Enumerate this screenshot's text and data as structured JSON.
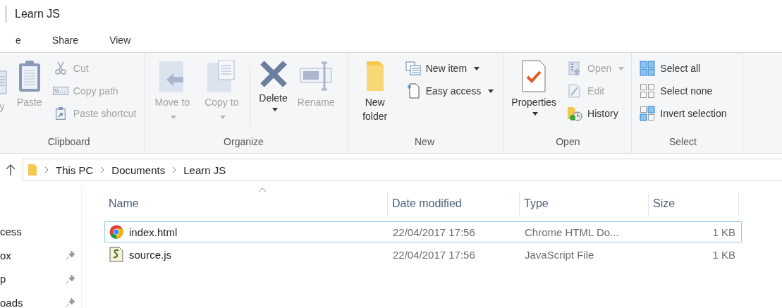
{
  "window": {
    "title": "Learn JS"
  },
  "tabs": [
    {
      "label": "e",
      "selected": false
    },
    {
      "label": "Share",
      "selected": false
    },
    {
      "label": "View",
      "selected": false
    }
  ],
  "ribbon": {
    "groups": [
      {
        "label": "Clipboard",
        "items": [
          {
            "kind": "large",
            "label": "y",
            "disabled": true,
            "dropdown": false
          },
          {
            "kind": "large",
            "label": "Paste",
            "disabled": true,
            "dropdown": false
          },
          {
            "kind": "small",
            "rows": [
              {
                "label": "Cut",
                "disabled": true,
                "dropdown": false
              },
              {
                "label": "Copy path",
                "disabled": true,
                "dropdown": false
              },
              {
                "label": "Paste shortcut",
                "disabled": true,
                "dropdown": false
              }
            ]
          }
        ]
      },
      {
        "label": "Organize",
        "items": [
          {
            "kind": "large",
            "label": "Move to",
            "disabled": true,
            "dropdown": true
          },
          {
            "kind": "large",
            "label": "Copy to",
            "disabled": true,
            "dropdown": true
          },
          {
            "kind": "large",
            "label": "Delete",
            "disabled": false,
            "dropdown": true
          },
          {
            "kind": "large",
            "label": "Rename",
            "disabled": true,
            "dropdown": false
          }
        ]
      },
      {
        "label": "New",
        "items": [
          {
            "kind": "large",
            "label": "New folder",
            "disabled": false,
            "dropdown": false
          },
          {
            "kind": "small",
            "rows": [
              {
                "label": "New item",
                "disabled": false,
                "dropdown": true
              },
              {
                "label": "Easy access",
                "disabled": false,
                "dropdown": true
              }
            ]
          }
        ]
      },
      {
        "label": "Open",
        "items": [
          {
            "kind": "large",
            "label": "Properties",
            "disabled": false,
            "dropdown": true
          },
          {
            "kind": "small",
            "rows": [
              {
                "label": "Open",
                "disabled": true,
                "dropdown": true
              },
              {
                "label": "Edit",
                "disabled": true,
                "dropdown": false
              },
              {
                "label": "History",
                "disabled": false,
                "dropdown": false
              }
            ]
          }
        ]
      },
      {
        "label": "Select",
        "items": [
          {
            "kind": "small",
            "rows": [
              {
                "label": "Select all",
                "disabled": false,
                "dropdown": false
              },
              {
                "label": "Select none",
                "disabled": false,
                "dropdown": false
              },
              {
                "label": "Invert selection",
                "disabled": false,
                "dropdown": false
              }
            ]
          }
        ]
      }
    ]
  },
  "address": {
    "path": [
      "This PC",
      "Documents",
      "Learn JS"
    ]
  },
  "sidebar": {
    "items": [
      {
        "label": "cess",
        "pinned": false
      },
      {
        "label": "ox",
        "pinned": true
      },
      {
        "label": "p",
        "pinned": true
      },
      {
        "label": "oads",
        "pinned": true
      }
    ]
  },
  "table": {
    "columns": [
      "Name",
      "Date modified",
      "Type",
      "Size"
    ],
    "rows": [
      {
        "kind": "chrome",
        "name": "index.html",
        "date": "22/04/2017 17:56",
        "type": "Chrome HTML Do...",
        "size": "1 KB",
        "selected": true
      },
      {
        "kind": "script",
        "name": "source.js",
        "date": "22/04/2017 17:56",
        "type": "JavaScript File",
        "size": "1 KB",
        "selected": false
      }
    ]
  }
}
